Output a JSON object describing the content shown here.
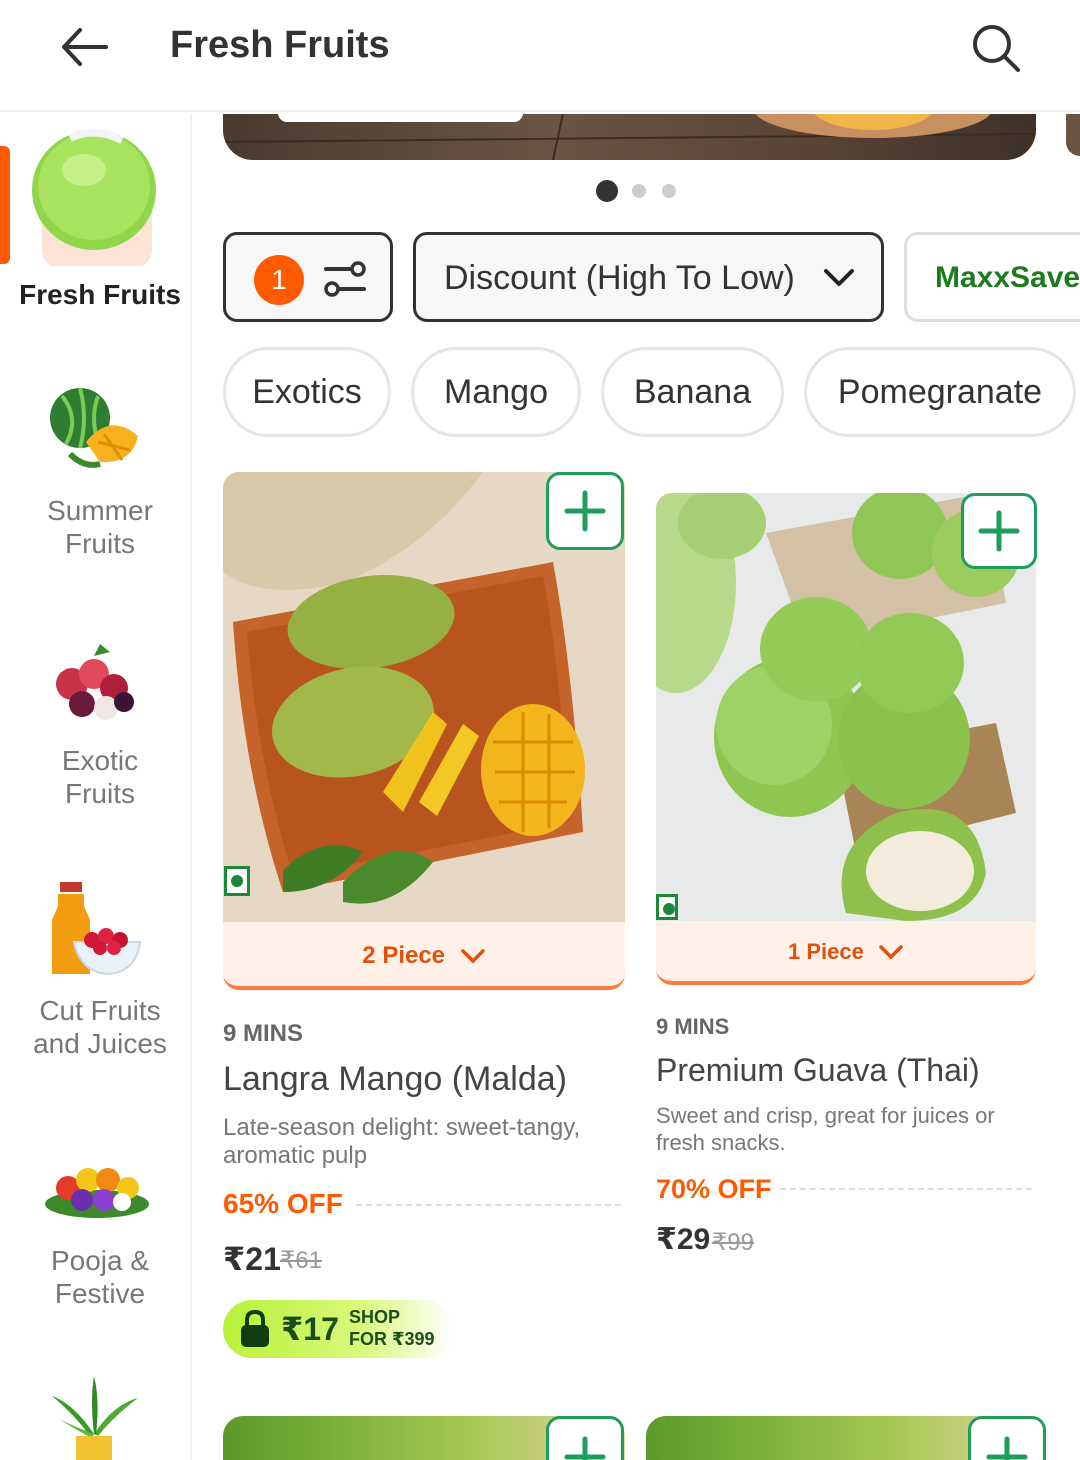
{
  "header": {
    "title": "Fresh Fruits"
  },
  "sidebar": {
    "items": [
      {
        "label": "Fresh Fruits",
        "icon": "coconut-icon"
      },
      {
        "label": "Summer Fruits",
        "icon": "watermelon-mango-icon"
      },
      {
        "label": "Exotic Fruits",
        "icon": "berries-icon"
      },
      {
        "label": "Cut Fruits and Juices",
        "icon": "juice-icon"
      },
      {
        "label": "Pooja & Festive",
        "icon": "flowers-icon"
      },
      {
        "label": "",
        "icon": "plant-icon"
      }
    ]
  },
  "banner": {
    "dots": 3,
    "active_dot": 0
  },
  "filters": {
    "count": "1",
    "sort_label": "Discount (High To Low)",
    "maxx_label": "MaxxSave"
  },
  "chips": [
    "Exotics",
    "Mango",
    "Banana",
    "Pomegranate"
  ],
  "products": [
    {
      "qty": "2 Piece",
      "eta": "9 MINS",
      "name": "Langra Mango (Malda)",
      "desc": "Late-season delight: sweet-tangy, aromatic pulp",
      "off": "65% OFF",
      "price": "₹21",
      "mrp": "₹61",
      "deal_price": "₹17",
      "deal_label": "SHOP FOR ₹399"
    },
    {
      "qty": "1 Piece",
      "eta": "9 MINS",
      "name": "Premium Guava (Thai)",
      "desc": "Sweet and crisp, great for juices or fresh snacks.",
      "off": "70% OFF",
      "price": "₹29",
      "mrp": "₹99"
    }
  ],
  "colors": {
    "accent": "#ff5a00",
    "green": "#1e9e5a",
    "deal_green": "#b8f23a"
  }
}
